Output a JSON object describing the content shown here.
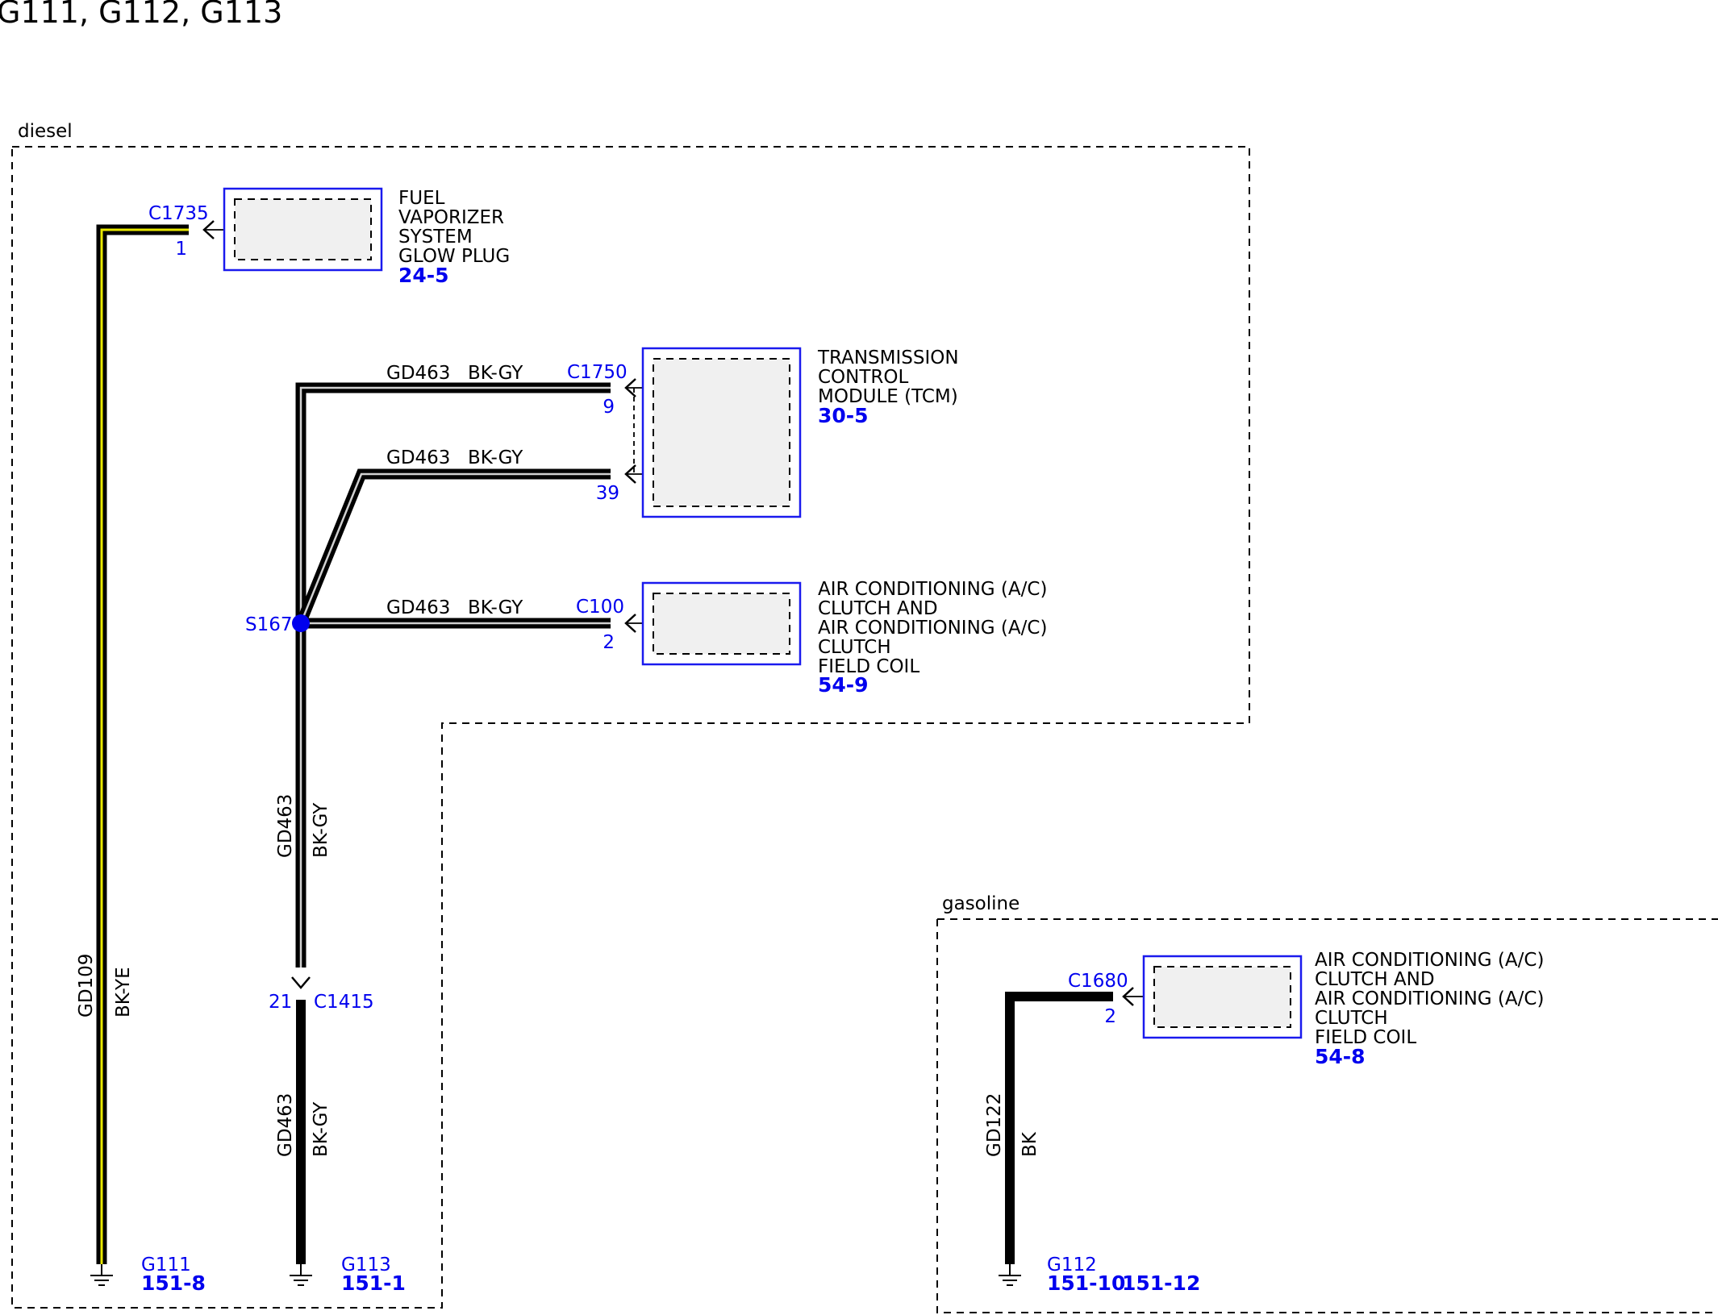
{
  "page_title": "G111, G112, G113",
  "sections": {
    "diesel": "diesel",
    "gasoline": "gasoline"
  },
  "components": {
    "glow_plug": {
      "connector": "C1735",
      "pin": "1",
      "lines": [
        "FUEL",
        "VAPORIZER",
        "SYSTEM",
        "GLOW PLUG"
      ],
      "ref": "24-5"
    },
    "tcm": {
      "connector": "C1750",
      "pins": [
        "9",
        "39"
      ],
      "lines": [
        "TRANSMISSION",
        "CONTROL",
        "MODULE (TCM)"
      ],
      "ref": "30-5"
    },
    "ac_clutch_diesel": {
      "connector": "C100",
      "pin": "2",
      "lines": [
        "AIR CONDITIONING (A/C)",
        "CLUTCH AND",
        "AIR CONDITIONING (A/C)",
        "CLUTCH",
        "FIELD COIL"
      ],
      "ref": "54-9"
    },
    "ac_clutch_gasoline": {
      "connector": "C1680",
      "pin": "2",
      "lines": [
        "AIR CONDITIONING (A/C)",
        "CLUTCH AND",
        "AIR CONDITIONING (A/C)",
        "CLUTCH",
        "FIELD COIL"
      ],
      "ref": "54-8"
    }
  },
  "wires": {
    "tcm_pin9": {
      "circuit": "GD463",
      "color": "BK-GY"
    },
    "tcm_pin39": {
      "circuit": "GD463",
      "color": "BK-GY"
    },
    "ac_diesel": {
      "circuit": "GD463",
      "color": "BK-GY"
    },
    "splice_down": {
      "circuit": "GD463",
      "color": "BK-GY"
    },
    "c1415_down": {
      "circuit": "GD463",
      "color": "BK-GY"
    },
    "glow_plug": {
      "circuit": "GD109",
      "color": "BK-YE"
    },
    "ac_gasoline": {
      "circuit": "GD122",
      "color": "BK"
    }
  },
  "splice": {
    "id": "S167"
  },
  "inline_connector": {
    "id": "C1415",
    "pin": "21"
  },
  "grounds": {
    "g111": {
      "id": "G111",
      "refs": [
        "151-8"
      ]
    },
    "g113": {
      "id": "G113",
      "refs": [
        "151-1"
      ]
    },
    "g112": {
      "id": "G112",
      "refs": [
        "151-10",
        "151-12"
      ]
    }
  }
}
